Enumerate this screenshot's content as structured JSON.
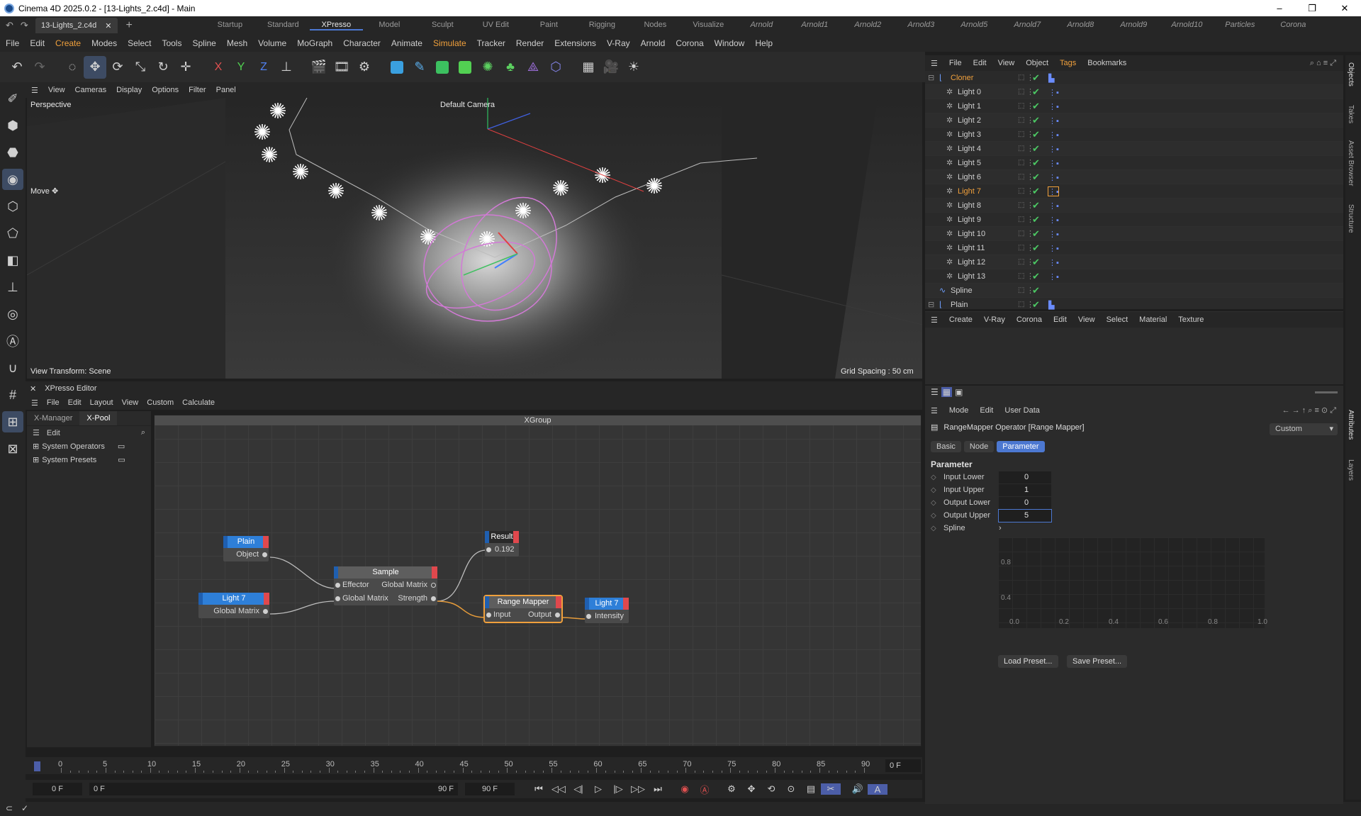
{
  "window": {
    "title": "Cinema 4D 2025.0.2 - [13-Lights_2.c4d] - Main",
    "doc_tab": "13-Lights_2.c4d",
    "controls": [
      "–",
      "❐",
      "✕"
    ]
  },
  "layouts": [
    "Startup",
    "Standard",
    "XPresso",
    "Model",
    "Sculpt",
    "UV Edit",
    "Paint",
    "Rigging",
    "Nodes",
    "Visualize",
    "Arnold",
    "Arnold1",
    "Arnold2",
    "Arnold3",
    "Arnold5",
    "Arnold7",
    "Arnold8",
    "Arnold9",
    "Arnold10",
    "Particles",
    "Corona"
  ],
  "active_layout": "XPresso",
  "menu": [
    "File",
    "Edit",
    "Create",
    "Modes",
    "Select",
    "Tools",
    "Spline",
    "Mesh",
    "Volume",
    "MoGraph",
    "Character",
    "Animate",
    "Simulate",
    "Tracker",
    "Render",
    "Extensions",
    "V-Ray",
    "Arnold",
    "Corona",
    "Window",
    "Help"
  ],
  "axis_labels": {
    "x": "X",
    "y": "Y",
    "z": "Z"
  },
  "viewport": {
    "menu": [
      "View",
      "Cameras",
      "Display",
      "Options",
      "Filter",
      "Panel"
    ],
    "perspective": "Perspective",
    "camera": "Default Camera",
    "tool": "Move ✥",
    "view_transform": "View Transform: Scene",
    "grid_spacing": "Grid Spacing : 50 cm"
  },
  "xpresso": {
    "title": "XPresso Editor",
    "menu": [
      "File",
      "Edit",
      "Layout",
      "View",
      "Custom",
      "Calculate"
    ],
    "tabs": [
      "X-Manager",
      "X-Pool"
    ],
    "edit": "Edit",
    "tree": [
      "System Operators",
      "System Presets"
    ],
    "group_title": "XGroup",
    "nodes": {
      "plain": {
        "title": "Plain",
        "port": "Object"
      },
      "light7a": {
        "title": "Light 7",
        "port": "Global Matrix"
      },
      "sample": {
        "title": "Sample",
        "in1": "Effector",
        "in2": "Global Matrix",
        "out1": "Global Matrix",
        "out2": "Strength"
      },
      "result": {
        "title": "Result",
        "value": "0.192"
      },
      "range": {
        "title": "Range Mapper",
        "in": "Input",
        "out": "Output"
      },
      "light7b": {
        "title": "Light 7",
        "port": "Intensity"
      }
    }
  },
  "timeline": {
    "ticks": [
      0,
      5,
      10,
      15,
      20,
      25,
      30,
      35,
      40,
      45,
      50,
      55,
      60,
      65,
      70,
      75,
      80,
      85,
      90
    ],
    "current": "0 F",
    "start": "0 F",
    "range_start": "0 F",
    "range_end": "90 F",
    "end": "90 F"
  },
  "objects": {
    "menu": [
      "File",
      "Edit",
      "View",
      "Object",
      "Tags",
      "Bookmarks"
    ],
    "items": [
      {
        "name": "Cloner",
        "level": 0,
        "hl": true
      },
      {
        "name": "Light 0",
        "level": 1
      },
      {
        "name": "Light 1",
        "level": 1
      },
      {
        "name": "Light 2",
        "level": 1
      },
      {
        "name": "Light 3",
        "level": 1
      },
      {
        "name": "Light 4",
        "level": 1
      },
      {
        "name": "Light 5",
        "level": 1
      },
      {
        "name": "Light 6",
        "level": 1
      },
      {
        "name": "Light 7",
        "level": 1,
        "hl": true
      },
      {
        "name": "Light 8",
        "level": 1
      },
      {
        "name": "Light 9",
        "level": 1
      },
      {
        "name": "Light 10",
        "level": 1
      },
      {
        "name": "Light 11",
        "level": 1
      },
      {
        "name": "Light 12",
        "level": 1
      },
      {
        "name": "Light 13",
        "level": 1
      },
      {
        "name": "Spline",
        "level": 0
      },
      {
        "name": "Plain",
        "level": 0
      }
    ]
  },
  "materials": {
    "menu": [
      "Create",
      "V-Ray",
      "Corona",
      "Edit",
      "View",
      "Select",
      "Material",
      "Texture"
    ]
  },
  "attributes": {
    "menu": [
      "Mode",
      "Edit",
      "User Data"
    ],
    "title": "RangeMapper Operator [Range Mapper]",
    "custom": "Custom",
    "tabs": [
      "Basic",
      "Node",
      "Parameter"
    ],
    "section": "Parameter",
    "params": [
      {
        "label": "Input Lower",
        "value": "0"
      },
      {
        "label": "Input Upper",
        "value": "1"
      },
      {
        "label": "Output Lower",
        "value": "0"
      },
      {
        "label": "Output Upper",
        "value": "5"
      }
    ],
    "spline_label": "Spline",
    "graph_y": [
      "0.8",
      "0.4"
    ],
    "graph_x": [
      "0.0",
      "0.2",
      "0.4",
      "0.6",
      "0.8",
      "1.0"
    ],
    "load_preset": "Load Preset...",
    "save_preset": "Save Preset..."
  },
  "side_tabs": [
    "Objects",
    "Takes",
    "Asset Browser",
    "Structure",
    "Attributes",
    "Layers"
  ]
}
